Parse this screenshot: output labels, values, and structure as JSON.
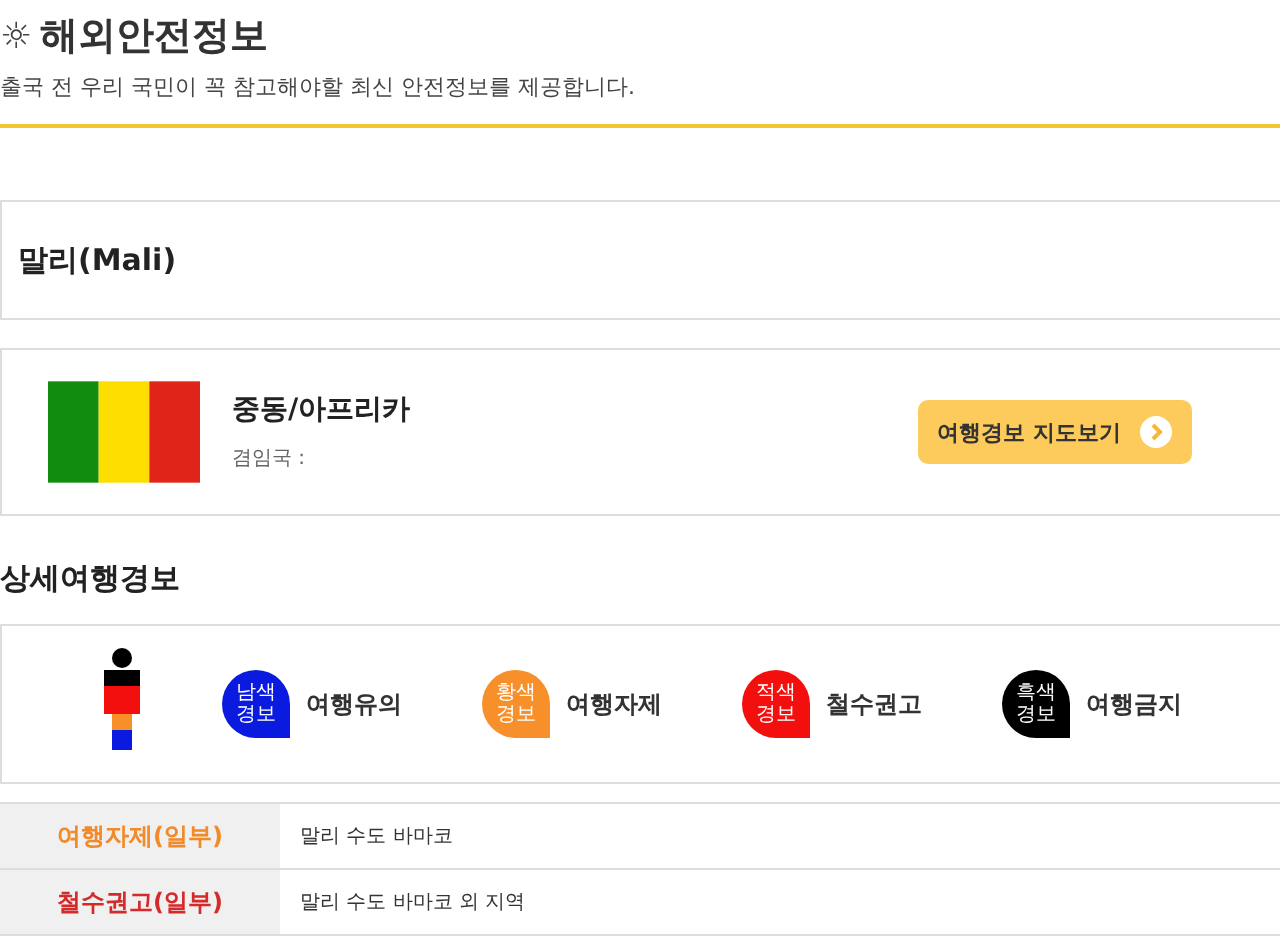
{
  "header": {
    "icon": "☼",
    "title": "해외안전정보",
    "subtitle": "출국 전 우리 국민이 꼭 참고해야할 최신 안전정보를 제공합니다."
  },
  "country": {
    "name": "말리(Mali)"
  },
  "info": {
    "region": "중동/아프리카",
    "neighbors": "겸임국 :",
    "map_button": "여행경보 지도보기"
  },
  "detail": {
    "heading": "상세여행경보",
    "legend": [
      {
        "badge": "남색\n경보",
        "label": "여행유의",
        "color": "#0a1adf"
      },
      {
        "badge": "황색\n경보",
        "label": "여행자제",
        "color": "#f7902a"
      },
      {
        "badge": "적색\n경보",
        "label": "철수권고",
        "color": "#f40f0f"
      },
      {
        "badge": "흑색\n경보",
        "label": "여행금지",
        "color": "#000000"
      }
    ],
    "rows": [
      {
        "level": "여행자제(일부)",
        "area": "말리 수도 바마코",
        "color": "#f08a2a"
      },
      {
        "level": "철수권고(일부)",
        "area": "말리 수도 바마코 외 지역",
        "color": "#d42a2a"
      }
    ]
  }
}
